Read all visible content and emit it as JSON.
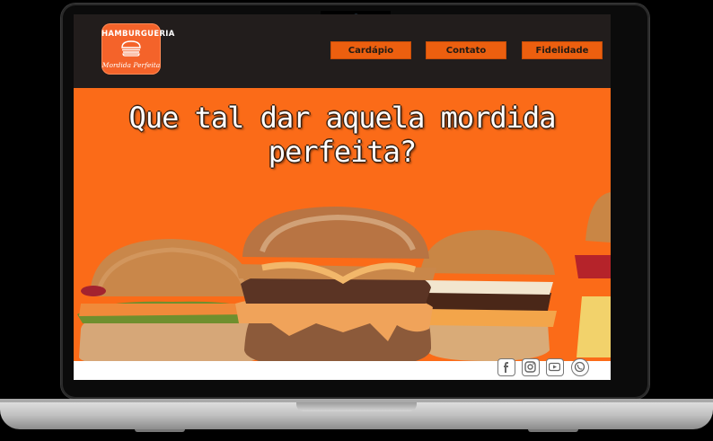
{
  "header": {
    "logo": {
      "top_text": "HAMBURGUERIA",
      "bottom_text": "Mordida Perfeita"
    },
    "nav": [
      {
        "label": "Cardápio"
      },
      {
        "label": "Contato"
      },
      {
        "label": "Fidelidade"
      }
    ]
  },
  "hero": {
    "title": "Que tal dar aquela mordida perfeita?"
  },
  "footer": {
    "social": [
      {
        "icon": "facebook-icon"
      },
      {
        "icon": "instagram-icon"
      },
      {
        "icon": "youtube-icon"
      },
      {
        "icon": "whatsapp-icon"
      }
    ]
  },
  "colors": {
    "brand_orange": "#fb6b18",
    "header_bg": "#221d1c",
    "nav_button": "#ec5f0f",
    "logo_bg": "#f4632a"
  }
}
